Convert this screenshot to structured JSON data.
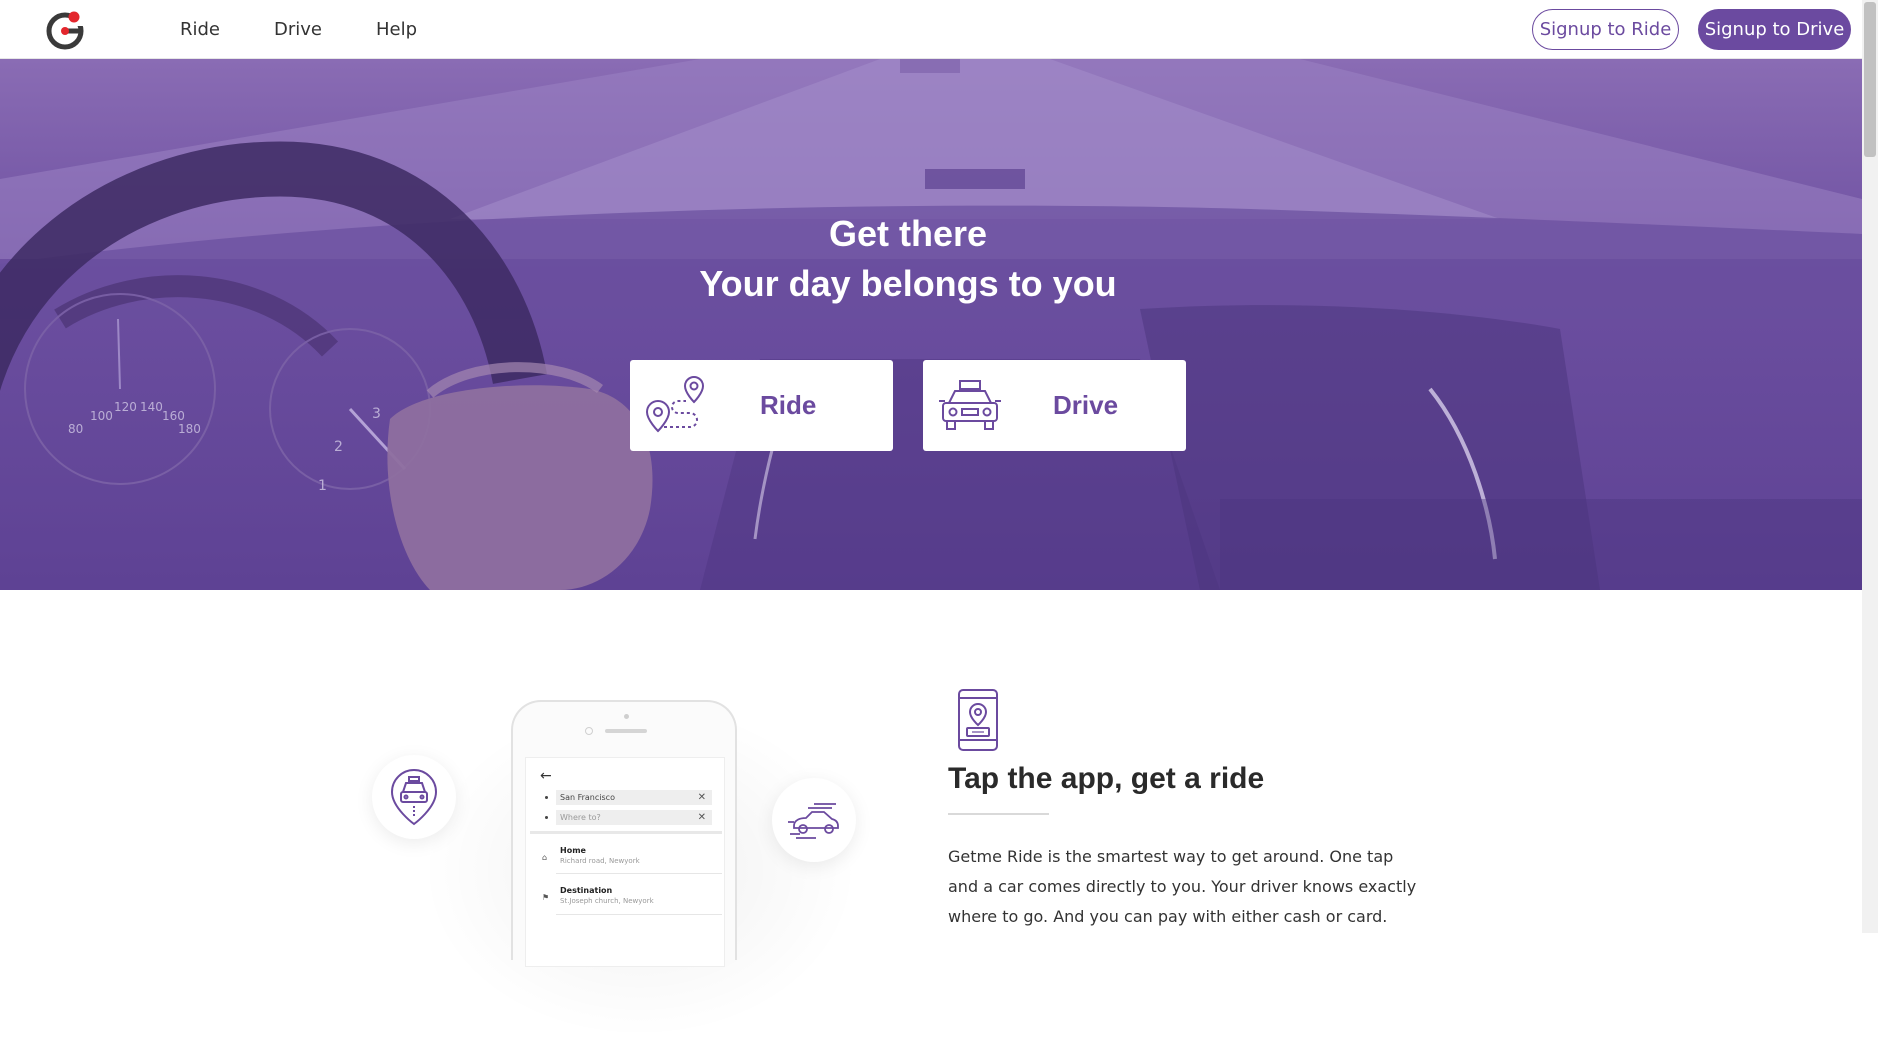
{
  "brand": {
    "logo_letter": "G",
    "accent_color": "#6b4a9f",
    "dot_color": "#e3262d"
  },
  "nav": {
    "items": [
      {
        "label": "Ride"
      },
      {
        "label": "Drive"
      },
      {
        "label": "Help"
      }
    ]
  },
  "header_actions": {
    "signup_ride": "Signup to Ride",
    "signup_drive": "Signup to Drive"
  },
  "hero": {
    "line1": "Get there",
    "line2": "Your day belongs to you",
    "ride_card": {
      "label": "Ride",
      "icon": "route-pins-icon"
    },
    "drive_card": {
      "label": "Drive",
      "icon": "taxi-car-icon"
    },
    "speedometer_ticks": [
      "80",
      "100",
      "120",
      "140",
      "160",
      "180"
    ],
    "tachometer_ticks": [
      "1",
      "2",
      "3"
    ]
  },
  "phone_screen": {
    "from_value": "San Francisco",
    "to_placeholder": "Where to?",
    "items": [
      {
        "title": "Home",
        "subtitle": "Richard road, Newyork"
      },
      {
        "title": "Destination",
        "subtitle": "St.Joseph church, Newyork"
      }
    ]
  },
  "feature": {
    "icon": "phone-taxi-icon",
    "title": "Tap the app, get a ride",
    "text": "Getme Ride is the smartest way to get around. One tap and a car comes directly to you. Your driver knows exactly where to go. And you can pay with either cash or card."
  }
}
